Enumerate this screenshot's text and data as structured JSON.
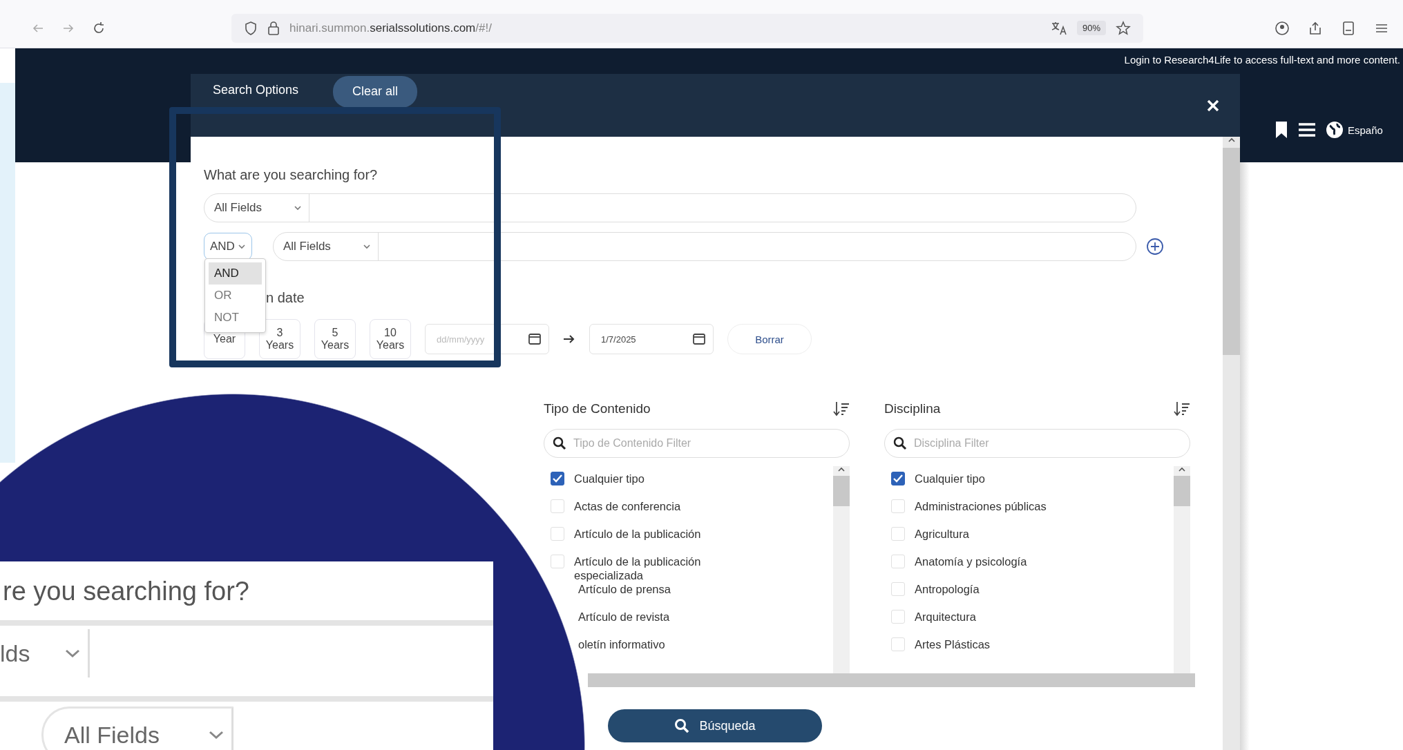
{
  "browser": {
    "url": "hinari.summon.**serialssolutions.com**/#!/",
    "zoom": "90%"
  },
  "site_header": {
    "login_notice": "Login to Research4Life to access full-text and more content.",
    "language": "Españo"
  },
  "modal": {
    "title": "Search Options",
    "clear_button": "Clear all",
    "prompt": "What are you searching for?",
    "query_rows": [
      {
        "field": "All Fields"
      },
      {
        "operator": "AND",
        "field": "All Fields"
      }
    ],
    "operator_menu": [
      {
        "label": "AND",
        "selected": true
      },
      {
        "label": "OR",
        "selected": false
      },
      {
        "label": "NOT",
        "selected": false
      }
    ],
    "date_heading": "n date",
    "ranges": [
      {
        "unit": "Year"
      },
      {
        "number": "3",
        "unit": "Years"
      },
      {
        "number": "5",
        "unit": "Years"
      },
      {
        "number": "10",
        "unit": "Years"
      }
    ],
    "date_from": {
      "placeholder": "dd/mm/yyyy"
    },
    "date_to": {
      "value": "1/7/2025"
    },
    "clear_dates": "Borrar",
    "facets": [
      {
        "title": "Tipo de Contenido",
        "filter_placeholder": "Tipo de Contenido Filter",
        "items": [
          {
            "label": "Cualquier tipo",
            "checked": true
          },
          {
            "label": "Actas de conferencia",
            "checked": false
          },
          {
            "label": "Artículo de la publicación",
            "checked": false
          },
          {
            "label": "Artículo de la publicación especializada",
            "checked": false
          },
          {
            "label": "Artículo de prensa"
          },
          {
            "label": "Artículo de revista"
          },
          {
            "label": "oletín informativo"
          }
        ]
      },
      {
        "title": "Disciplina",
        "filter_placeholder": "Disciplina Filter",
        "items": [
          {
            "label": "Cualquier tipo",
            "checked": true
          },
          {
            "label": "Administraciones públicas",
            "checked": false
          },
          {
            "label": "Agricultura",
            "checked": false
          },
          {
            "label": "Anatomía y psicología",
            "checked": false
          },
          {
            "label": "Antropología",
            "checked": false
          },
          {
            "label": "Arquitectura",
            "checked": false
          },
          {
            "label": "Artes Plásticas",
            "checked": false
          }
        ]
      }
    ],
    "search_button": "Búsqueda"
  },
  "inset": {
    "prompt": "re you searching for?",
    "field_1": "lds",
    "field_2": "All Fields"
  }
}
